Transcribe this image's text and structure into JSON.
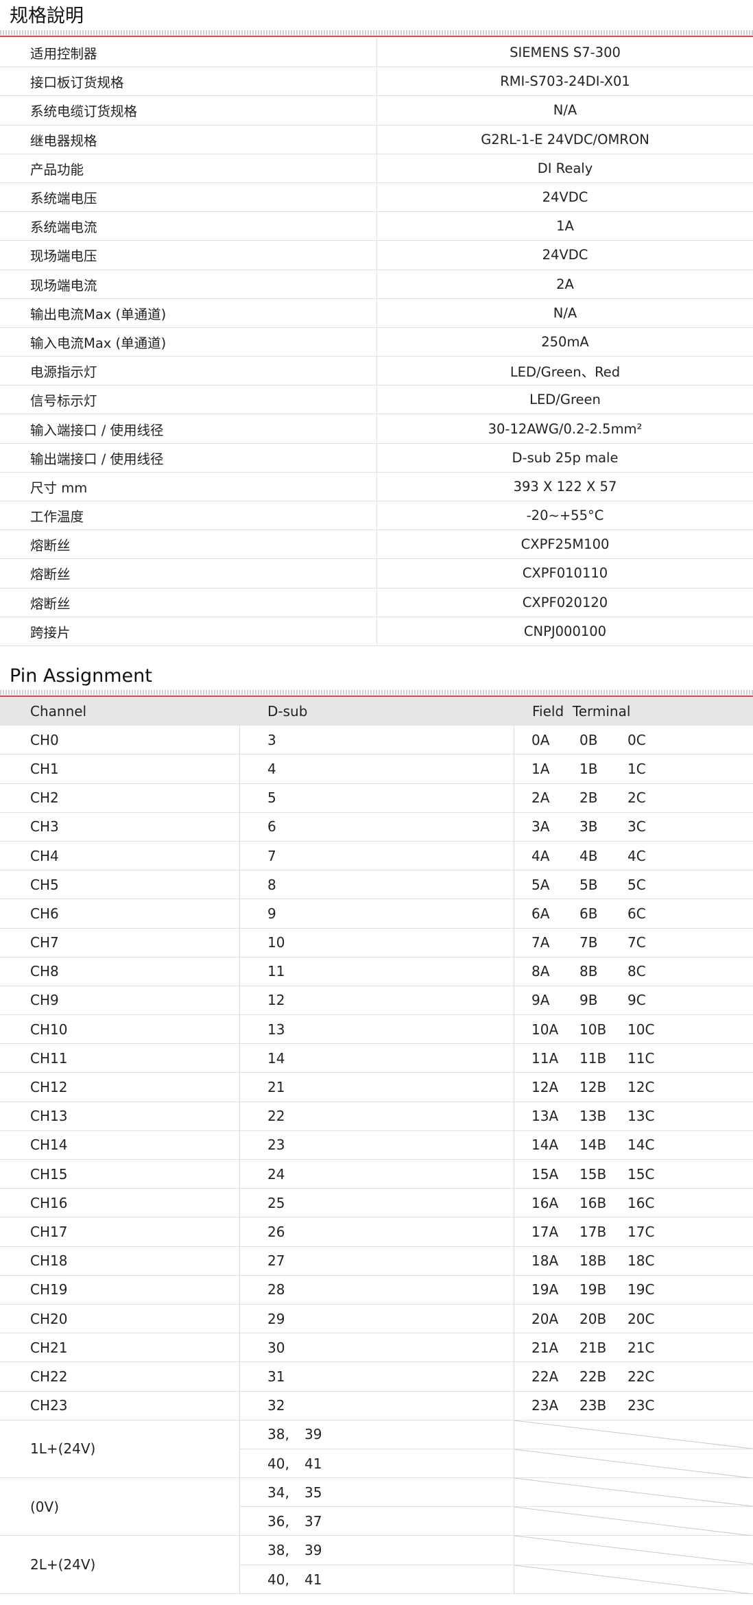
{
  "spec": {
    "title": "规格說明",
    "rows": [
      {
        "label": "适用控制器",
        "value": "SIEMENS S7-300"
      },
      {
        "label": "接口板订货规格",
        "value": "RMI-S703-24DI-X01"
      },
      {
        "label": "系统电缆订货规格",
        "value": "N/A"
      },
      {
        "label": "继电器规格",
        "value": "G2RL-1-E 24VDC/OMRON"
      },
      {
        "label": "产品功能",
        "value": "DI Realy"
      },
      {
        "label": "系统端电压",
        "value": "24VDC"
      },
      {
        "label": "系统端电流",
        "value": "1A"
      },
      {
        "label": "现场端电压",
        "value": "24VDC"
      },
      {
        "label": "现场端电流",
        "value": "2A"
      },
      {
        "label": "输出电流Max (单通道)",
        "value": "N/A"
      },
      {
        "label": "输入电流Max (单通道)",
        "value": "250mA"
      },
      {
        "label": "电源指示灯",
        "value": "LED/Green、Red"
      },
      {
        "label": "信号标示灯",
        "value": "LED/Green"
      },
      {
        "label": "输入端接口 / 使用线径",
        "value": "30-12AWG/0.2-2.5mm²"
      },
      {
        "label": "输出端接口 / 使用线径",
        "value": "D-sub 25p male"
      },
      {
        "label": "尺寸 mm",
        "value": "393 X 122 X 57"
      },
      {
        "label": "工作温度",
        "value": "-20~+55°C"
      },
      {
        "label": "熔断丝",
        "value": "CXPF25M100"
      },
      {
        "label": "熔断丝",
        "value": "CXPF010110"
      },
      {
        "label": "熔断丝",
        "value": "CXPF020120"
      },
      {
        "label": "跨接片",
        "value": "CNPJ000100"
      }
    ]
  },
  "pins": {
    "title": "Pin Assignment",
    "headers": {
      "channel": "Channel",
      "dsub": "D-sub",
      "field": "Field  Terminal"
    },
    "rows": [
      {
        "channel": "CH0",
        "dsub": "3",
        "field": [
          "0A",
          "0B",
          "0C"
        ]
      },
      {
        "channel": "CH1",
        "dsub": "4",
        "field": [
          "1A",
          "1B",
          "1C"
        ]
      },
      {
        "channel": "CH2",
        "dsub": "5",
        "field": [
          "2A",
          "2B",
          "2C"
        ]
      },
      {
        "channel": "CH3",
        "dsub": "6",
        "field": [
          "3A",
          "3B",
          "3C"
        ]
      },
      {
        "channel": "CH4",
        "dsub": "7",
        "field": [
          "4A",
          "4B",
          "4C"
        ]
      },
      {
        "channel": "CH5",
        "dsub": "8",
        "field": [
          "5A",
          "5B",
          "5C"
        ]
      },
      {
        "channel": "CH6",
        "dsub": "9",
        "field": [
          "6A",
          "6B",
          "6C"
        ]
      },
      {
        "channel": "CH7",
        "dsub": "10",
        "field": [
          "7A",
          "7B",
          "7C"
        ]
      },
      {
        "channel": "CH8",
        "dsub": "11",
        "field": [
          "8A",
          "8B",
          "8C"
        ]
      },
      {
        "channel": "CH9",
        "dsub": "12",
        "field": [
          "9A",
          "9B",
          "9C"
        ]
      },
      {
        "channel": "CH10",
        "dsub": "13",
        "field": [
          "10A",
          "10B",
          "10C"
        ]
      },
      {
        "channel": "CH11",
        "dsub": "14",
        "field": [
          "11A",
          "11B",
          "11C"
        ]
      },
      {
        "channel": "CH12",
        "dsub": "21",
        "field": [
          "12A",
          "12B",
          "12C"
        ]
      },
      {
        "channel": "CH13",
        "dsub": "22",
        "field": [
          "13A",
          "13B",
          "13C"
        ]
      },
      {
        "channel": "CH14",
        "dsub": "23",
        "field": [
          "14A",
          "14B",
          "14C"
        ]
      },
      {
        "channel": "CH15",
        "dsub": "24",
        "field": [
          "15A",
          "15B",
          "15C"
        ]
      },
      {
        "channel": "CH16",
        "dsub": "25",
        "field": [
          "16A",
          "16B",
          "16C"
        ]
      },
      {
        "channel": "CH17",
        "dsub": "26",
        "field": [
          "17A",
          "17B",
          "17C"
        ]
      },
      {
        "channel": "CH18",
        "dsub": "27",
        "field": [
          "18A",
          "18B",
          "18C"
        ]
      },
      {
        "channel": "CH19",
        "dsub": "28",
        "field": [
          "19A",
          "19B",
          "19C"
        ]
      },
      {
        "channel": "CH20",
        "dsub": "29",
        "field": [
          "20A",
          "20B",
          "20C"
        ]
      },
      {
        "channel": "CH21",
        "dsub": "30",
        "field": [
          "21A",
          "21B",
          "21C"
        ]
      },
      {
        "channel": "CH22",
        "dsub": "31",
        "field": [
          "22A",
          "22B",
          "22C"
        ]
      },
      {
        "channel": "CH23",
        "dsub": "32",
        "field": [
          "23A",
          "23B",
          "23C"
        ]
      }
    ],
    "power": [
      {
        "label": "1L+(24V)",
        "pins": [
          [
            "38,",
            "39"
          ],
          [
            "40,",
            "41"
          ]
        ]
      },
      {
        "label": "(0V)",
        "pins": [
          [
            "34,",
            "35"
          ],
          [
            "36,",
            "37"
          ]
        ]
      },
      {
        "label": "2L+(24V)",
        "pins": [
          [
            "38,",
            "39"
          ],
          [
            "40,",
            "41"
          ]
        ]
      }
    ]
  }
}
